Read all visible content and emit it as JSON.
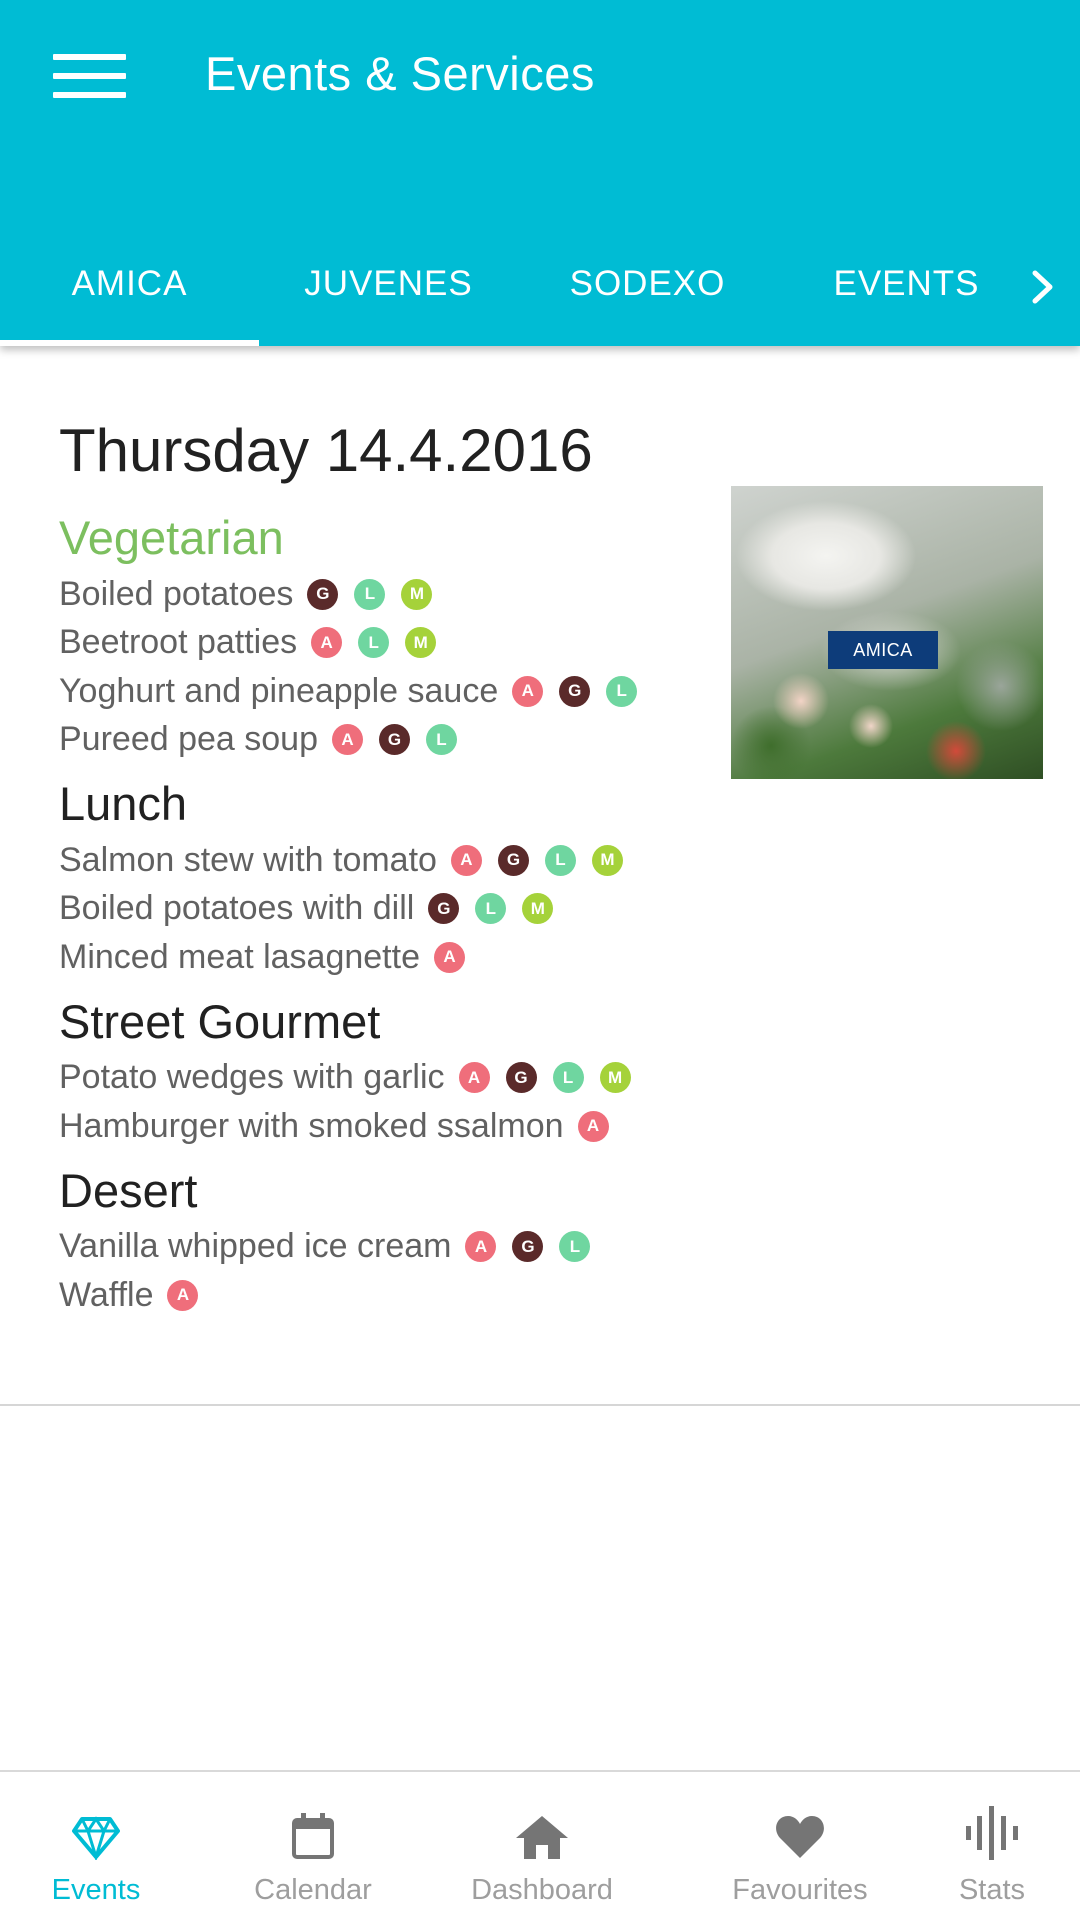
{
  "colors": {
    "primary": "#00bcd4",
    "category_highlight": "#7cbf5f",
    "tag_A": "#ef6e7b",
    "tag_G": "#5a2a2a",
    "tag_L": "#6fd6a0",
    "tag_M": "#a5d23a",
    "nav_inactive": "#9e9e9e"
  },
  "app_bar": {
    "title": "Events & Services",
    "menu_icon": "hamburger-menu-icon"
  },
  "tabs": [
    {
      "label": "AMICA",
      "active": true
    },
    {
      "label": "JUVENES",
      "active": false
    },
    {
      "label": "SODEXO",
      "active": false
    },
    {
      "label": "EVENTS",
      "active": false
    }
  ],
  "tab_next_icon": "chevron-right-icon",
  "menu": {
    "date": "Thursday 14.4.2016",
    "image_badge": "AMICA",
    "categories": [
      {
        "name": "Vegetarian",
        "items": [
          {
            "name": "Boiled potatoes",
            "tags": [
              "G",
              "L",
              "M"
            ]
          },
          {
            "name": "Beetroot patties",
            "tags": [
              "A",
              "L",
              "M"
            ]
          },
          {
            "name": "Yoghurt and pineapple sauce",
            "tags": [
              "A",
              "G",
              "L"
            ]
          },
          {
            "name": "Pureed pea soup",
            "tags": [
              "A",
              "G",
              "L"
            ]
          }
        ]
      },
      {
        "name": "Lunch",
        "items": [
          {
            "name": "Salmon stew with tomato",
            "tags": [
              "A",
              "G",
              "L",
              "M"
            ]
          },
          {
            "name": "Boiled potatoes with dill",
            "tags": [
              "G",
              "L",
              "M"
            ]
          },
          {
            "name": "Minced meat lasagnette",
            "tags": [
              "A"
            ]
          }
        ]
      },
      {
        "name": "Street Gourmet",
        "items": [
          {
            "name": "Potato wedges with garlic",
            "tags": [
              "A",
              "G",
              "L",
              "M"
            ]
          },
          {
            "name": "Hamburger with smoked ssalmon",
            "tags": [
              "A"
            ]
          }
        ]
      },
      {
        "name": "Desert",
        "items": [
          {
            "name": "Vanilla whipped ice cream",
            "tags": [
              "A",
              "G",
              "L"
            ]
          },
          {
            "name": "Waffle",
            "tags": [
              "A"
            ]
          }
        ]
      }
    ]
  },
  "bottom_nav": [
    {
      "label": "Events",
      "icon": "diamond-icon",
      "active": true
    },
    {
      "label": "Calendar",
      "icon": "calendar-icon",
      "active": false
    },
    {
      "label": "Dashboard",
      "icon": "home-icon",
      "active": false
    },
    {
      "label": "Favourites",
      "icon": "heart-icon",
      "active": false
    },
    {
      "label": "Stats",
      "icon": "stats-icon",
      "active": false
    }
  ]
}
